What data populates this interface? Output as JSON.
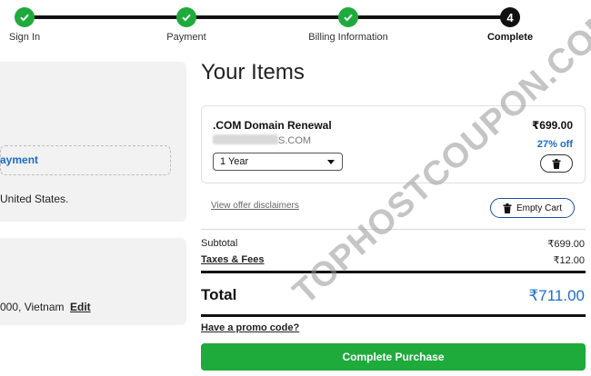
{
  "steps": [
    {
      "label": "Sign In",
      "state": "done",
      "icon": "check-icon"
    },
    {
      "label": "Payment",
      "state": "done",
      "icon": "check-icon"
    },
    {
      "label": "Billing Information",
      "state": "done",
      "icon": "check-icon"
    },
    {
      "label": "Complete",
      "state": "current",
      "number": "4"
    }
  ],
  "left": {
    "payment_link": "ayment",
    "country_text": "United States.",
    "address_text": "000, Vietnam",
    "edit_label": "Edit"
  },
  "items": {
    "title": "Your Items",
    "item": {
      "name": ".COM Domain Renewal",
      "domain_suffix": "S.COM",
      "term": "1 Year",
      "price": "₹699.00",
      "discount": "27% off",
      "remove_icon": "trash-icon"
    },
    "disclaimer_link": "View offer disclaimers",
    "empty_cart_label": "Empty Cart"
  },
  "summary": {
    "subtotal_label": "Subtotal",
    "subtotal_value": "₹699.00",
    "taxes_label": "Taxes & Fees",
    "taxes_value": "₹12.00",
    "total_label": "Total",
    "total_value": "₹711.00",
    "promo_link": "Have a promo code?",
    "complete_button": "Complete Purchase"
  },
  "watermark": "TOPHOSTCOUPON.COM",
  "colors": {
    "accent_green": "#1faa3c",
    "link_blue": "#1a6dcc",
    "dark": "#111111"
  }
}
